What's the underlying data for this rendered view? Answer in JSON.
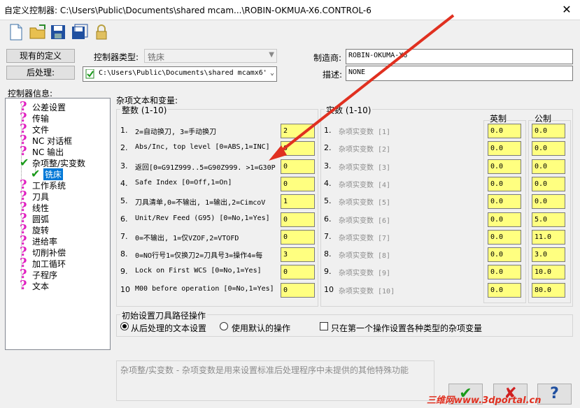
{
  "window": {
    "title": "自定义控制器: C:\\Users\\Public\\Documents\\shared mcam...\\ROBIN-OKMUA-X6.CONTROL-6",
    "close": "✕"
  },
  "toolbar": {
    "icons": [
      "new-file-icon",
      "open-folder-icon",
      "save-icon",
      "save-as-icon",
      "lock-icon"
    ]
  },
  "header": {
    "existing_def_button": "现有的定义",
    "post_button": "后处理:",
    "controller_type_label": "控制器类型:",
    "controller_type_value": "铣床",
    "post_path": "C:\\Users\\Public\\Documents\\shared mcamx6'",
    "manufacturer_label": "制造商:",
    "manufacturer_value": "ROBIN-OKUMA-X6",
    "description_label": "描述:",
    "description_value": "NONE"
  },
  "tree": {
    "label": "控制器信息:",
    "items": [
      {
        "label": "公差设置",
        "mark": "?"
      },
      {
        "label": "传输",
        "mark": "?"
      },
      {
        "label": "文件",
        "mark": "?"
      },
      {
        "label": "NC 对话框",
        "mark": "?"
      },
      {
        "label": "NC 输出",
        "mark": "?"
      },
      {
        "label": "杂项整/实变数",
        "mark": "✔"
      },
      {
        "label": "铣床",
        "mark": "✔"
      },
      {
        "label": "工作系统",
        "mark": "?"
      },
      {
        "label": "刀具",
        "mark": "?"
      },
      {
        "label": "线性",
        "mark": "?"
      },
      {
        "label": "圆弧",
        "mark": "?"
      },
      {
        "label": "旋转",
        "mark": "?"
      },
      {
        "label": "进给率",
        "mark": "?"
      },
      {
        "label": "切削补偿",
        "mark": "?"
      },
      {
        "label": "加工循环",
        "mark": "?"
      },
      {
        "label": "子程序",
        "mark": "?"
      },
      {
        "label": "文本",
        "mark": "?"
      }
    ]
  },
  "misc": {
    "section_title": "杂项文本和变量:",
    "int_title": "整数 (1-10)",
    "real_title": "实数 (1-10)",
    "col_imperial": "英制",
    "col_metric": "公制",
    "int_rows": [
      {
        "n": "1.",
        "label": "2=自动换刀, 3=手动换刀",
        "value": "2"
      },
      {
        "n": "2.",
        "label": "Abs/Inc, top level [0=ABS,1=INC]",
        "value": "0"
      },
      {
        "n": "3.",
        "label": "返回[0=G91Z999..5=G90Z999. >1=G30P",
        "value": "0"
      },
      {
        "n": "4.",
        "label": "Safe Index [0=Off,1=On]",
        "value": "0"
      },
      {
        "n": "5.",
        "label": "刀具清单,0=不输出, 1=输出,2=CimcoV",
        "value": "1"
      },
      {
        "n": "6.",
        "label": "Unit/Rev Feed (G95) [0=No,1=Yes]",
        "value": "0"
      },
      {
        "n": "7.",
        "label": "0=不输出, 1=仅VZOF,2=VTOFD",
        "value": "0"
      },
      {
        "n": "8.",
        "label": "0=NO行号1=仅换刀2=刀具号3=操作4=每",
        "value": "3"
      },
      {
        "n": "9.",
        "label": "Lock on First WCS [0=No,1=Yes]",
        "value": "0"
      },
      {
        "n": "10",
        "label": "M00 before operation [0=No,1=Yes]",
        "value": "0"
      }
    ],
    "real_rows": [
      {
        "n": "1.",
        "label": "杂项实变数 [1]",
        "imperial": "0.0",
        "metric": "0.0"
      },
      {
        "n": "2.",
        "label": "杂项实变数 [2]",
        "imperial": "0.0",
        "metric": "0.0"
      },
      {
        "n": "3.",
        "label": "杂项实变数 [3]",
        "imperial": "0.0",
        "metric": "0.0"
      },
      {
        "n": "4.",
        "label": "杂项实变数 [4]",
        "imperial": "0.0",
        "metric": "0.0"
      },
      {
        "n": "5.",
        "label": "杂项实变数 [5]",
        "imperial": "0.0",
        "metric": "0.0"
      },
      {
        "n": "6.",
        "label": "杂项实变数 [6]",
        "imperial": "0.0",
        "metric": "5.0"
      },
      {
        "n": "7.",
        "label": "杂项实变数 [7]",
        "imperial": "0.0",
        "metric": "11.0"
      },
      {
        "n": "8.",
        "label": "杂项实变数 [8]",
        "imperial": "0.0",
        "metric": "3.0"
      },
      {
        "n": "9.",
        "label": "杂项实变数 [9]",
        "imperial": "0.0",
        "metric": "10.0"
      },
      {
        "n": "10",
        "label": "杂项实变数 [10]",
        "imperial": "0.0",
        "metric": "80.0"
      }
    ]
  },
  "init": {
    "title": "初始设置刀具路径操作",
    "opt1": "从后处理的文本设置",
    "opt2": "使用默认的操作",
    "opt3": "只在第一个操作设置各种类型的杂项变量"
  },
  "help_text": "杂项整/实变数 - 杂项变数是用来设置标准后处理程序中未提供的其他特殊功能",
  "buttons": {
    "ok": "✔",
    "cancel": "✘",
    "help": "?"
  },
  "watermark": "三维网www.3dportal.cn",
  "colors": {
    "accent": "#0078d7",
    "field_yellow": "#ffff80",
    "arrow_red": "#e03020",
    "question": "#e020c0",
    "check": "#1a9a1a"
  }
}
